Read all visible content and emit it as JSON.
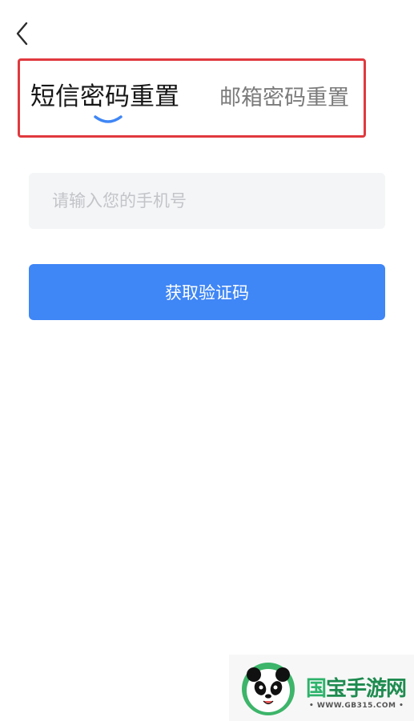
{
  "header": {
    "back_icon": "chevron-left-icon"
  },
  "tabs": [
    {
      "label": "短信密码重置",
      "active": true
    },
    {
      "label": "邮箱密码重置",
      "active": false
    }
  ],
  "form": {
    "phone_placeholder": "请输入您的手机号",
    "phone_value": "",
    "submit_label": "获取验证码"
  },
  "watermark": {
    "title_first": "国",
    "title_rest": "宝手游网",
    "url": "• WWW.GB315.COM •"
  },
  "colors": {
    "accent": "#3f86f6",
    "highlight_border": "#e0393e",
    "input_bg": "#f4f5f7",
    "active_tab_text": "#161616",
    "inactive_tab_text": "#7b7b7b"
  }
}
